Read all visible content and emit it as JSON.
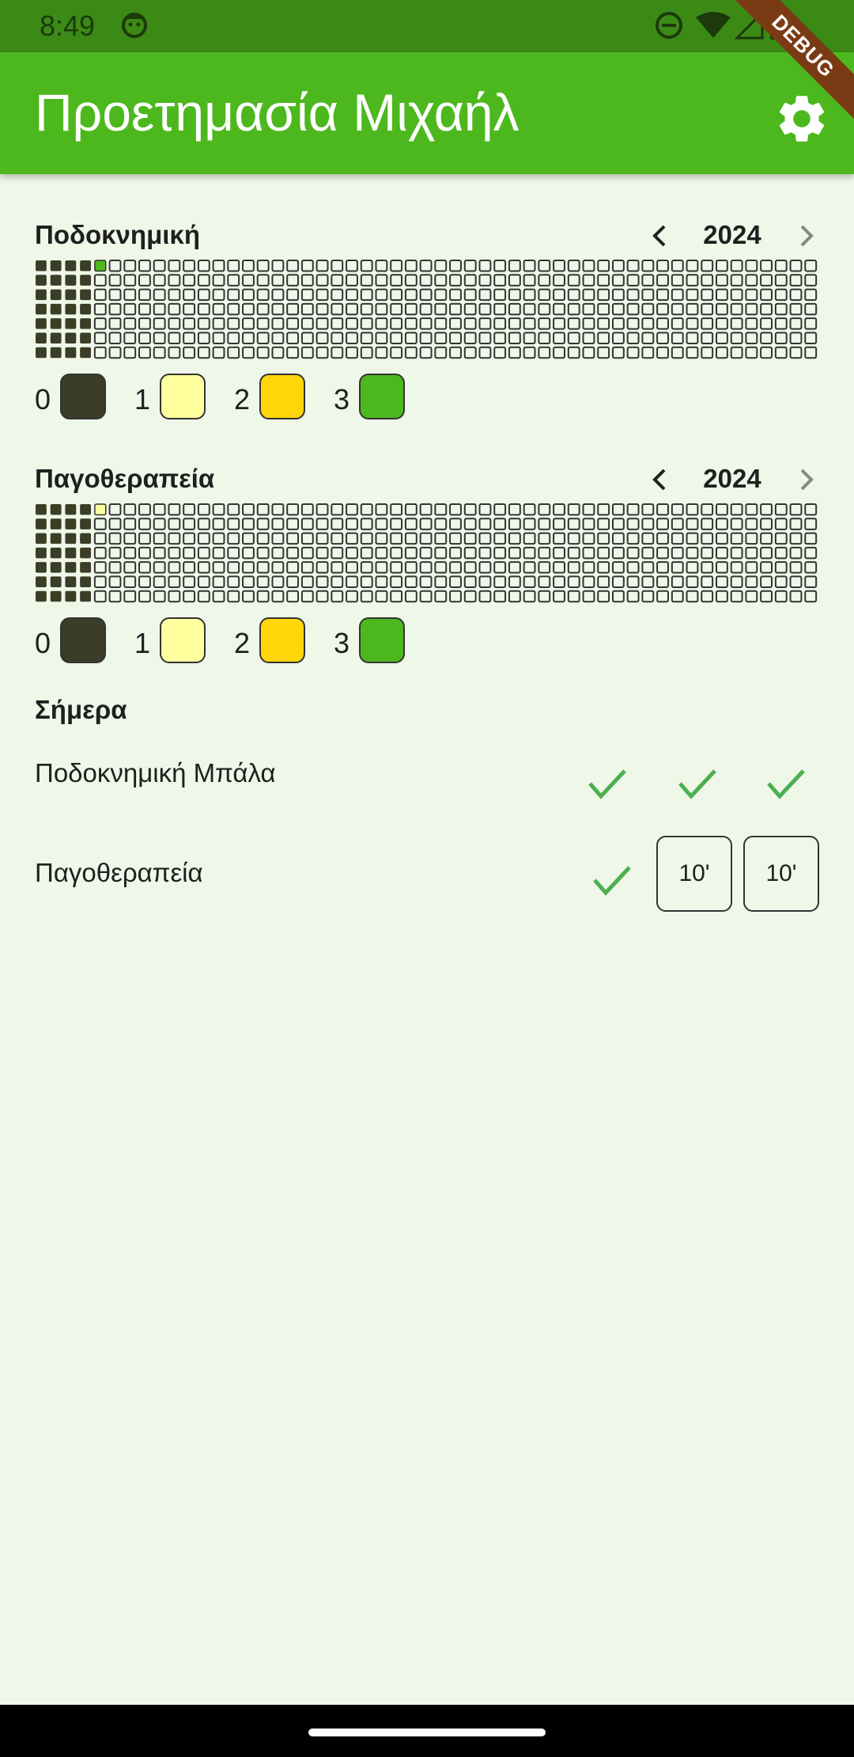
{
  "status": {
    "time": "8:49"
  },
  "app": {
    "title": "Προετημασία Μιχαήλ",
    "debug_label": "DEBUG"
  },
  "icons": {
    "settings": "gear-icon",
    "prev": "chevron-left-icon",
    "next": "chevron-right-icon",
    "check": "check-icon",
    "dnd": "do-not-disturb-icon",
    "wifi": "wifi-icon",
    "signal": "cellular-signal-icon",
    "battery": "battery-icon"
  },
  "colors": {
    "level0": "#3b3d26",
    "level1": "#ffff9e",
    "level2": "#ffd60a",
    "level3": "#4cb81e",
    "check": "#4caf50",
    "appbar": "#4cb81e",
    "statusbar": "#3b8a16"
  },
  "heatmaps": [
    {
      "title": "Ποδοκνημική",
      "year": "2024",
      "legend": [
        {
          "label": "0"
        },
        {
          "label": "1"
        },
        {
          "label": "2"
        },
        {
          "label": "3"
        }
      ],
      "filled_weeks": 4,
      "today_level": 3
    },
    {
      "title": "Παγοθεραπεία",
      "year": "2024",
      "legend": [
        {
          "label": "0"
        },
        {
          "label": "1"
        },
        {
          "label": "2"
        },
        {
          "label": "3"
        }
      ],
      "filled_weeks": 4,
      "today_level": 1
    }
  ],
  "today": {
    "title": "Σήμερα",
    "habits": [
      {
        "name": "Ποδοκνημική Μπάλα",
        "checks": 3
      },
      {
        "name": "Παγοθεραπεία",
        "checks": 1,
        "timers": [
          "10'",
          "10'"
        ]
      }
    ]
  }
}
